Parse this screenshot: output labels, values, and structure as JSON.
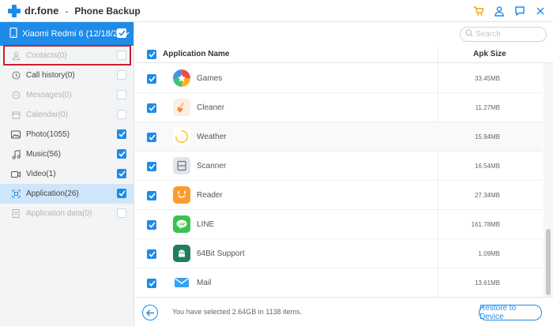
{
  "app": {
    "brand": "dr.fone",
    "separator": "-",
    "title": "Phone Backup",
    "accent_color": "#1f8be8",
    "window_icons": [
      "cart-icon",
      "user-icon",
      "feedback-icon",
      "close-icon"
    ]
  },
  "device": {
    "name": "Xiaomi Redmi 6 (12/18/2",
    "icon": "phone-icon",
    "selected": true
  },
  "sidebar": {
    "items": [
      {
        "label": "Contacts(0)",
        "icon": "person-icon",
        "checked": false,
        "disabled": true
      },
      {
        "label": "Call history(0)",
        "icon": "clock-icon",
        "checked": false,
        "disabled": false
      },
      {
        "label": "Messages(0)",
        "icon": "message-icon",
        "checked": false,
        "disabled": true
      },
      {
        "label": "Calendar(0)",
        "icon": "calendar-icon",
        "checked": false,
        "disabled": true
      },
      {
        "label": "Photo(1055)",
        "icon": "photo-icon",
        "checked": true,
        "disabled": false
      },
      {
        "label": "Music(56)",
        "icon": "music-icon",
        "checked": true,
        "disabled": false
      },
      {
        "label": "Video(1)",
        "icon": "video-icon",
        "checked": true,
        "disabled": false
      },
      {
        "label": "Application(26)",
        "icon": "apps-icon",
        "checked": true,
        "disabled": false,
        "active": true
      },
      {
        "label": "Application data(0)",
        "icon": "doc-icon",
        "checked": false,
        "disabled": true
      }
    ]
  },
  "search": {
    "placeholder": "Search"
  },
  "table": {
    "headers": {
      "name": "Application Name",
      "size": "Apk Size"
    },
    "rows": [
      {
        "name": "Games",
        "size": "33.45MB",
        "icon": "games-icon"
      },
      {
        "name": "Cleaner",
        "size": "11.27MB",
        "icon": "cleaner-icon"
      },
      {
        "name": "Weather",
        "size": "15.94MB",
        "icon": "weather-icon"
      },
      {
        "name": "Scanner",
        "size": "16.54MB",
        "icon": "scanner-icon"
      },
      {
        "name": "Reader",
        "size": "27.34MB",
        "icon": "reader-icon"
      },
      {
        "name": "LINE",
        "size": "161.78MB",
        "icon": "line-icon"
      },
      {
        "name": "64Bit Support",
        "size": "1.09MB",
        "icon": "android-icon"
      },
      {
        "name": "Mail",
        "size": "13.61MB",
        "icon": "mail-icon"
      }
    ]
  },
  "footer": {
    "selection_text": "You have selected 2.64GB in 1138 items.",
    "restore_label": "Restore to Device"
  }
}
